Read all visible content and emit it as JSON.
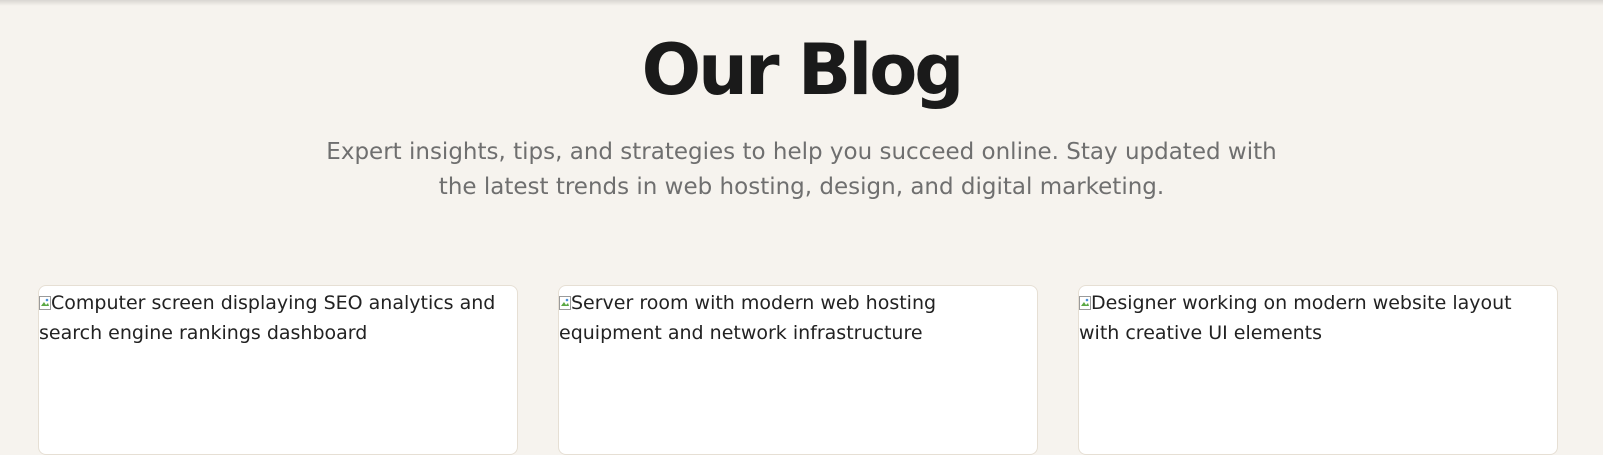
{
  "header": {
    "title": "Our Blog",
    "subtitle": "Expert insights, tips, and strategies to help you succeed online. Stay updated with the latest trends in web hosting, design, and digital marketing."
  },
  "cards": [
    {
      "image_alt": "Computer screen displaying SEO analytics and search engine rankings dashboard"
    },
    {
      "image_alt": "Server room with modern web hosting equipment and network infrastructure"
    },
    {
      "image_alt": "Designer working on modern website layout with creative UI elements"
    }
  ],
  "colors": {
    "background": "#f6f3ee",
    "title": "#1a1a1a",
    "subtitle": "#6f6f6f",
    "card_background": "#ffffff",
    "card_border": "#e6dfd4"
  },
  "icons": {
    "broken_image": "broken-image-icon"
  }
}
